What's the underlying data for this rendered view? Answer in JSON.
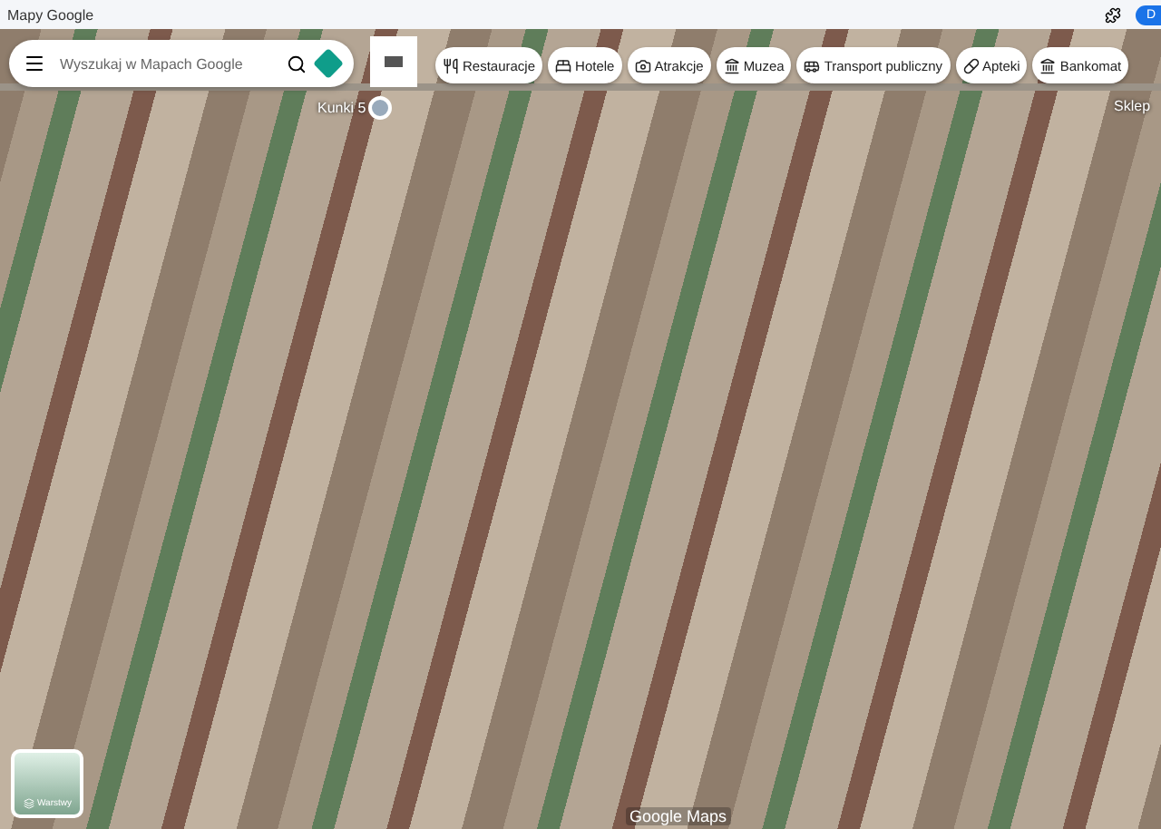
{
  "window": {
    "title": "Mapy Google",
    "account_initial": "D"
  },
  "search": {
    "placeholder": "Wyszukaj w Mapach Google"
  },
  "chips": [
    {
      "label": "Restauracje",
      "kind": "food"
    },
    {
      "label": "Hotele",
      "kind": "hotel"
    },
    {
      "label": "Atrakcje",
      "kind": "camera"
    },
    {
      "label": "Muzea",
      "kind": "museum"
    },
    {
      "label": "Transport publiczny",
      "kind": "transit"
    },
    {
      "label": "Apteki",
      "kind": "pharmacy"
    },
    {
      "label": "Bankomat",
      "kind": "atm"
    }
  ],
  "map": {
    "place_labels": [
      "Kunki 5",
      "Sklep"
    ],
    "attribution": "Google Maps"
  },
  "layers": {
    "label": "Warstwy"
  }
}
